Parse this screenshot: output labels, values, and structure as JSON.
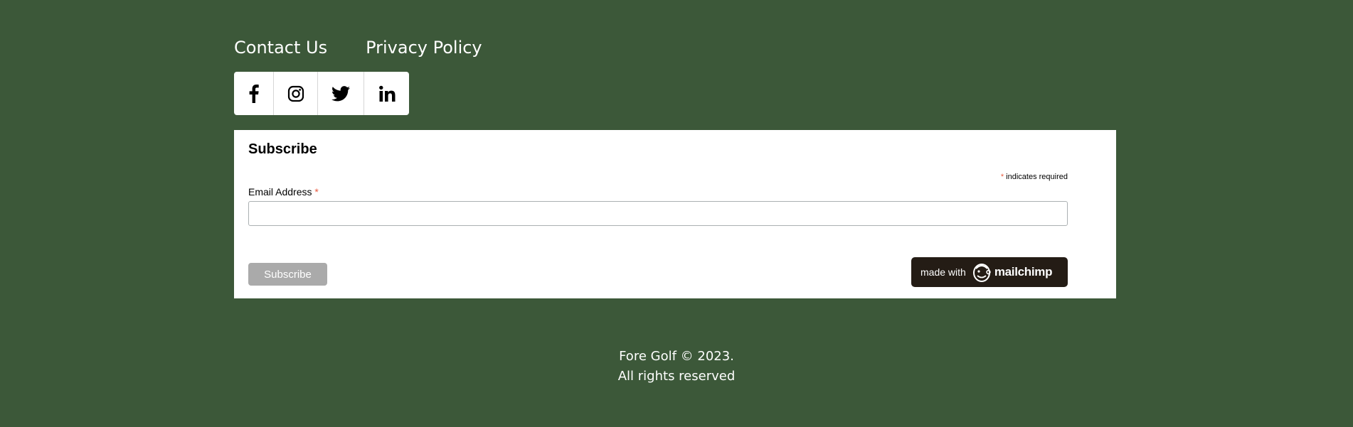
{
  "colors": {
    "page_background": "#3c5839",
    "panel_background": "#ffffff",
    "required_asterisk": "#e85c41",
    "subscribe_button": "#aaaaaa",
    "mailchimp_badge": "#241c15"
  },
  "footer_links": [
    {
      "label": "Contact Us"
    },
    {
      "label": "Privacy Policy"
    }
  ],
  "social": [
    {
      "icon": "facebook-icon"
    },
    {
      "icon": "instagram-icon"
    },
    {
      "icon": "twitter-icon"
    },
    {
      "icon": "linkedin-icon"
    }
  ],
  "subscribe": {
    "heading": "Subscribe",
    "required_mark": "*",
    "required_note": " indicates required",
    "email_label": "Email Address ",
    "email_value": "",
    "button_label": "Subscribe",
    "badge_prefix": "made with",
    "badge_brand": "mailchimp"
  },
  "copyright": {
    "line1": "Fore Golf © 2023.",
    "line2": "All rights reserved"
  }
}
